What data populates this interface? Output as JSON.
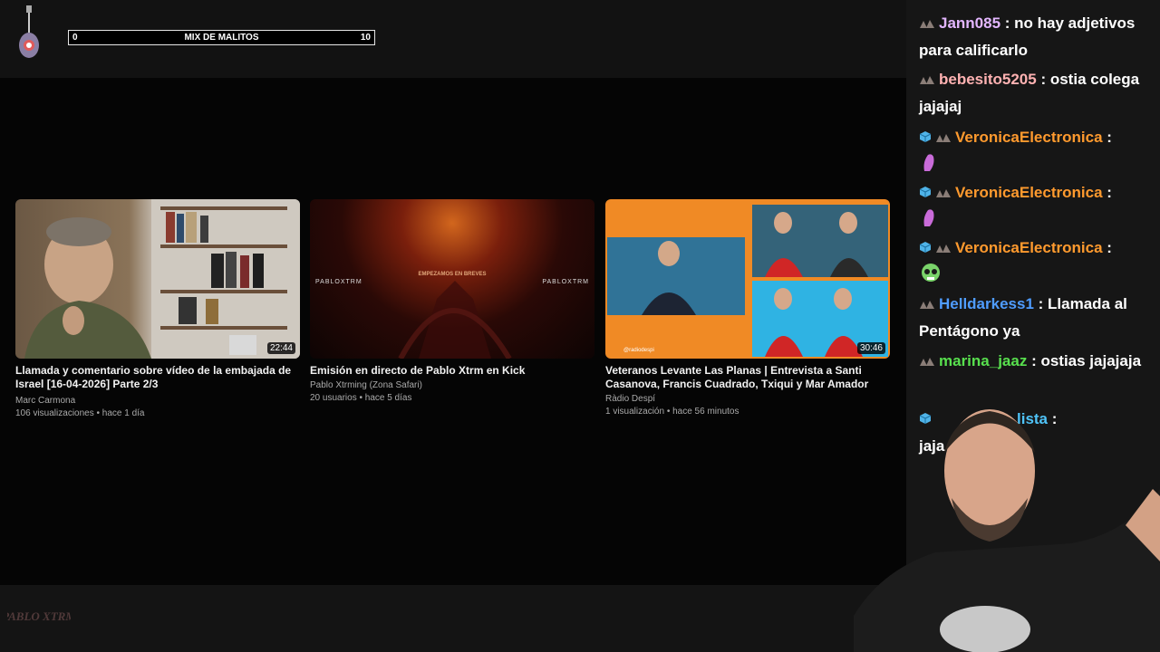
{
  "overlay": {
    "counter": {
      "min": "0",
      "label": "MIX DE MALITOS",
      "max": "10"
    }
  },
  "videos": [
    {
      "title": "Llamada y comentario sobre vídeo de la embajada de Israel [16-04-2026] Parte 2/3",
      "channel": "Marc Carmona",
      "stats": "106 visualizaciones • hace 1 día",
      "duration": "22:44"
    },
    {
      "title": "Emisión en directo de Pablo Xtrm en Kick",
      "channel": "Pablo Xtrming (Zona Safari)",
      "stats": "20 usuarios • hace 5 días",
      "thumb_text": "EMPEZAMOS EN BREVES",
      "thumb_side": "PABLOXTRM"
    },
    {
      "title": "Veteranos Levante Las Planas | Entrevista a Santi Casanova, Francis Cuadrado, Txiqui y Mar Amador",
      "channel": "Ràdio Despí",
      "stats": "1 visualización • hace 56 minutos",
      "duration": "30:46",
      "thumb_text": "@radiodespi"
    }
  ],
  "chat": {
    "messages": [
      {
        "user": "Jann085",
        "sep": " : ",
        "text": "no hay adjetivos para calificarlo",
        "color": "#e3b6ff"
      },
      {
        "user": "bebesito5205",
        "sep": " : ",
        "text": "ostia colega jajajaj",
        "color": "#ffb2b2"
      },
      {
        "user": "VeronicaElectronica",
        "sep": " : ",
        "text": "",
        "color": "#ff9a2e",
        "emote": "lipstick-emote"
      },
      {
        "user": "VeronicaElectronica",
        "sep": " : ",
        "text": "",
        "color": "#ff9a2e",
        "emote": "lipstick-emote"
      },
      {
        "user": "VeronicaElectronica",
        "sep": " : ",
        "text": "",
        "color": "#ff9a2e",
        "emote": "skull-emote"
      },
      {
        "user": "Helldarkess1",
        "sep": " : ",
        "text": "Llamada al Pentágono ya",
        "color": "#4f9cff"
      },
      {
        "user": "marina_jaaz",
        "sep": " : ",
        "text": "ostias jajajaja",
        "color": "#58e04e"
      },
      {
        "user": "lista",
        "sep": " : ",
        "text": "jaja ajajaja",
        "color": "#4fc3f7"
      }
    ]
  },
  "watermark": "PABLO XTRM"
}
